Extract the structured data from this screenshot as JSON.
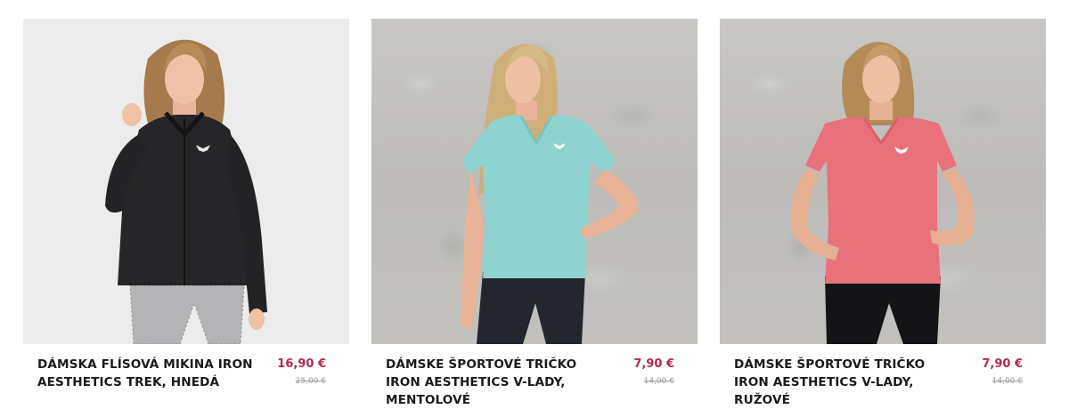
{
  "products": [
    {
      "title": "DÁMSKA FLÍSOVÁ MIKINA IRON AESTHETICS TREK, HNEDÁ",
      "price": "16,90 €",
      "old_price": "25,00 €",
      "garment_color": "#262628",
      "background": "studio"
    },
    {
      "title": "DÁMSKE ŠPORTOVÉ TRIČKO IRON AESTHETICS V-LADY, MENTOLOVÉ",
      "price": "7,90 €",
      "old_price": "14,00 €",
      "garment_color": "#8ed3cf",
      "background": "concrete"
    },
    {
      "title": "DÁMSKE ŠPORTOVÉ TRIČKO IRON AESTHETICS V-LADY, RUŽOVÉ",
      "price": "7,90 €",
      "old_price": "14,00 €",
      "garment_color": "#e9717c",
      "background": "concrete"
    }
  ],
  "colors": {
    "price": "#b02a4e",
    "old_price": "#9a9a9a",
    "title": "#1b1b1b"
  }
}
